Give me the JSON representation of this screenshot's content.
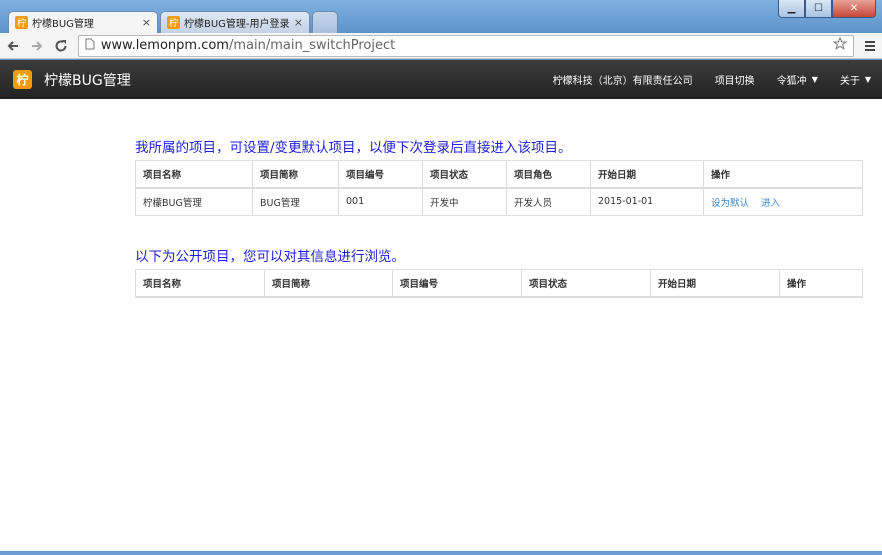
{
  "browser": {
    "tabs": [
      {
        "icon_char": "柠",
        "title": "柠檬BUG管理",
        "active": true
      },
      {
        "icon_char": "柠",
        "title": "柠檬BUG管理-用户登录",
        "active": false
      }
    ],
    "tab_close_glyph": "×",
    "url_host": "www.lemonpm.com",
    "url_path": "/main/main_switchProject",
    "window_controls": {
      "minimize": "▁",
      "maximize": "☐",
      "close": "✕"
    }
  },
  "navbar": {
    "logo_char": "柠",
    "brand": "柠檬BUG管理",
    "items": [
      {
        "label": "柠檬科技（北京）有限责任公司",
        "dropdown": false
      },
      {
        "label": "项目切换",
        "dropdown": false
      },
      {
        "label": "令狐冲",
        "dropdown": true
      },
      {
        "label": "关于",
        "dropdown": true
      }
    ]
  },
  "my_projects": {
    "title": "我所属的项目，可设置/变更默认项目，以便下次登录后直接进入该项目。",
    "columns": [
      "项目名称",
      "项目简称",
      "项目编号",
      "项目状态",
      "项目角色",
      "开始日期",
      "操作"
    ],
    "rows": [
      {
        "name": "柠檬BUG管理",
        "short": "BUG管理",
        "code": "001",
        "status": "开发中",
        "role": "开发人员",
        "start": "2015-01-01",
        "actions": [
          "设为默认",
          "进入"
        ]
      }
    ]
  },
  "public_projects": {
    "title": "以下为公开项目，您可以对其信息进行浏览。",
    "columns": [
      "项目名称",
      "项目简称",
      "项目编号",
      "项目状态",
      "开始日期",
      "操作"
    ],
    "rows": []
  },
  "icons": {
    "back": "back-arrow-icon",
    "forward": "forward-arrow-icon",
    "reload": "reload-icon",
    "page": "page-icon",
    "star": "star-icon",
    "menu": "menu-icon"
  }
}
